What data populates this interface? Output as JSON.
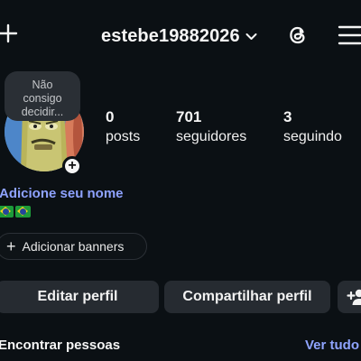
{
  "header": {
    "username": "estebe19882026",
    "create_icon": "plus-icon",
    "account_switch_icon": "chevron-down-icon",
    "threads_icon": "threads-icon",
    "menu_icon": "hamburger-menu-icon"
  },
  "note": {
    "line1": "Não",
    "line2": "consigo",
    "line3": "decidir..."
  },
  "profile": {
    "avatar_add_symbol": "+",
    "name_prompt": "Adicione seu nome",
    "bio_flags": [
      "brazil-flag",
      "brazil-flag"
    ]
  },
  "stats": [
    {
      "value": "0",
      "label": "posts"
    },
    {
      "value": "701",
      "label": "seguidores"
    },
    {
      "value": "3",
      "label": "seguindo"
    }
  ],
  "banners": {
    "plus_symbol": "+",
    "label": "Adicionar banners"
  },
  "actions": {
    "edit_profile": "Editar perfil",
    "share_profile": "Compartilhar perfil",
    "add_person_icon": "add-person-icon"
  },
  "discover": {
    "title": "Encontrar pessoas",
    "see_all": "Ver tudo"
  },
  "colors": {
    "background": "#0b1014",
    "accent_link": "#8ea2ff",
    "button_bg": "#262b31"
  }
}
